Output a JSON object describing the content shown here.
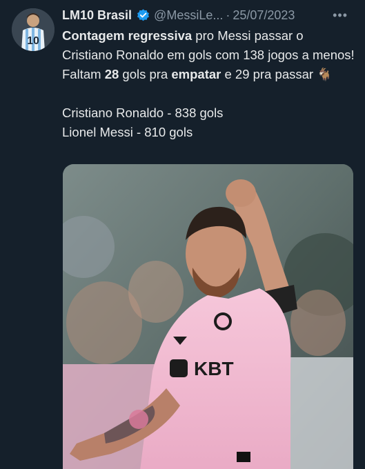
{
  "author": {
    "name": "LM10 Brasil",
    "handle": "@MessiLe...",
    "separator": "·",
    "date": "25/07/2023",
    "more": "•••",
    "avatar_icon": "messi-avatar-icon",
    "verified_icon": "verified-badge-icon"
  },
  "tweet": {
    "line1_bold": "Contagem regressiva",
    "line1_rest": " pro Messi passar o Cristiano Ronaldo em gols com 138 jogos a menos! Faltam ",
    "line2_bold1": "28",
    "line2_mid": " gols pra ",
    "line2_bold2": "empatar",
    "line2_rest": " e 29 pra passar ",
    "emoji": "🐐",
    "stat1": "Cristiano Ronaldo - 838 gols",
    "stat2": "Lionel Messi - 810 gols"
  },
  "media": {
    "shirt_text": "KBT",
    "photo_icon": "messi-celebration-photo"
  },
  "colors": {
    "background": "#15202b",
    "text": "#e7e9ea",
    "secondary": "#8b98a5",
    "verified": "#1d9bf0",
    "shirt_pink": "#f3b8d0"
  }
}
